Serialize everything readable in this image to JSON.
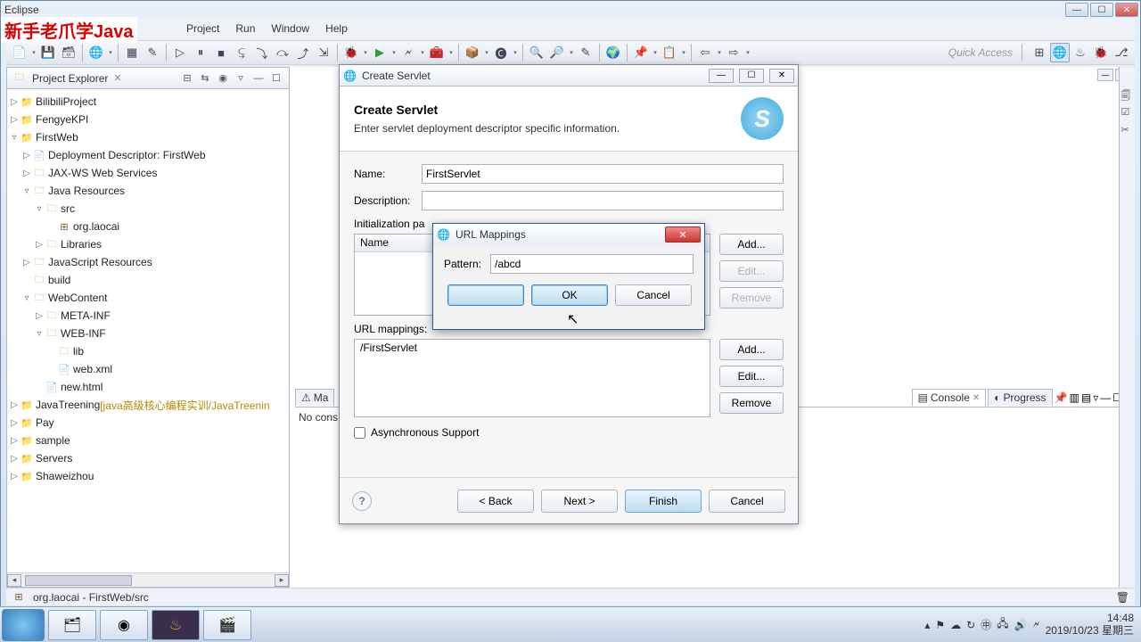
{
  "window": {
    "title": "Eclipse"
  },
  "watermark": "新手老爪学Java",
  "menu": [
    "Project",
    "Run",
    "Window",
    "Help"
  ],
  "quick_access": "Quick Access",
  "explorer": {
    "title": "Project Explorer",
    "items": [
      {
        "l": 0,
        "exp": "▷",
        "icon": "proj",
        "txt": "BilibiliProject"
      },
      {
        "l": 0,
        "exp": "▷",
        "icon": "proj",
        "txt": "FengyeKPI"
      },
      {
        "l": 0,
        "exp": "▿",
        "icon": "proj",
        "txt": "FirstWeb"
      },
      {
        "l": 1,
        "exp": "▷",
        "icon": "file",
        "txt": "Deployment Descriptor: FirstWeb"
      },
      {
        "l": 1,
        "exp": "▷",
        "icon": "folder",
        "txt": "JAX-WS Web Services"
      },
      {
        "l": 1,
        "exp": "▿",
        "icon": "folder",
        "txt": "Java Resources"
      },
      {
        "l": 2,
        "exp": "▿",
        "icon": "folder",
        "txt": "src"
      },
      {
        "l": 3,
        "exp": "",
        "icon": "pkg",
        "txt": "org.laocai"
      },
      {
        "l": 2,
        "exp": "▷",
        "icon": "folder",
        "txt": "Libraries"
      },
      {
        "l": 1,
        "exp": "▷",
        "icon": "folder",
        "txt": "JavaScript Resources"
      },
      {
        "l": 1,
        "exp": "",
        "icon": "folder",
        "txt": "build"
      },
      {
        "l": 1,
        "exp": "▿",
        "icon": "folder",
        "txt": "WebContent"
      },
      {
        "l": 2,
        "exp": "▷",
        "icon": "folder",
        "txt": "META-INF"
      },
      {
        "l": 2,
        "exp": "▿",
        "icon": "folder",
        "txt": "WEB-INF"
      },
      {
        "l": 3,
        "exp": "",
        "icon": "folder",
        "txt": "lib"
      },
      {
        "l": 3,
        "exp": "",
        "icon": "file",
        "txt": "web.xml"
      },
      {
        "l": 2,
        "exp": "",
        "icon": "file",
        "txt": "new.html"
      },
      {
        "l": 0,
        "exp": "▷",
        "icon": "proj",
        "txt": "JavaTreening",
        "deco": " [java高级核心编程实训/JavaTreenin"
      },
      {
        "l": 0,
        "exp": "▷",
        "icon": "proj",
        "txt": "Pay"
      },
      {
        "l": 0,
        "exp": "▷",
        "icon": "proj",
        "txt": "sample"
      },
      {
        "l": 0,
        "exp": "▷",
        "icon": "proj",
        "txt": "Servers"
      },
      {
        "l": 0,
        "exp": "▷",
        "icon": "proj",
        "txt": "Shaweizhou"
      }
    ]
  },
  "bottom": {
    "tabs": [
      "Ma",
      "Console",
      "Progress"
    ],
    "body": "No cons"
  },
  "status": "org.laocai - FirstWeb/src",
  "wizard": {
    "title": "Create Servlet",
    "heading": "Create Servlet",
    "sub": "Enter servlet deployment descriptor specific information.",
    "name_label": "Name:",
    "name_value": "FirstServlet",
    "desc_label": "Description:",
    "init_label": "Initialization pa",
    "init_header": "Name",
    "url_label": "URL mappings:",
    "url_item": "/FirstServlet",
    "add": "Add...",
    "edit": "Edit...",
    "remove": "Remove",
    "async": "Asynchronous Support",
    "back": "< Back",
    "next": "Next >",
    "finish": "Finish",
    "cancel": "Cancel"
  },
  "subdialog": {
    "title": "URL Mappings",
    "pattern_label": "Pattern:",
    "pattern_value": "/abcd",
    "ok": "OK",
    "cancel": "Cancel"
  },
  "taskbar": {
    "time": "14:48",
    "date": "2019/10/23 星期三"
  }
}
